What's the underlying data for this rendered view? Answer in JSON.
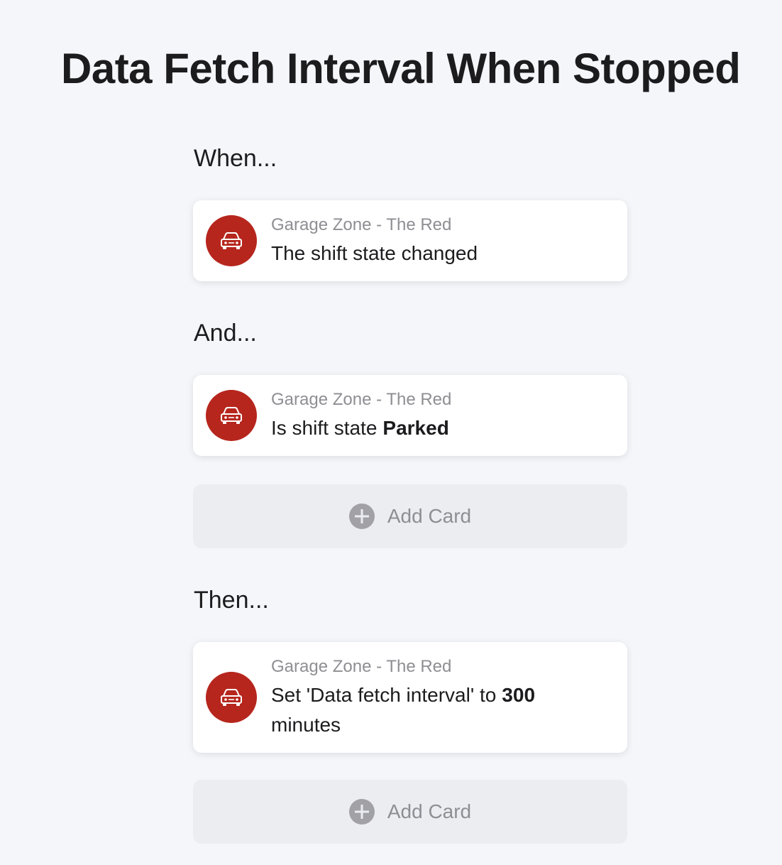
{
  "page": {
    "title": "Data Fetch Interval When Stopped"
  },
  "sections": {
    "when": {
      "label": "When...",
      "card": {
        "zone": "Garage Zone - The Red",
        "description": "The shift state changed",
        "icon": "car-icon"
      }
    },
    "and": {
      "label": "And...",
      "card": {
        "zone": "Garage Zone - The Red",
        "description_prefix": "Is shift state",
        "description_value": "Parked",
        "icon": "car-icon"
      },
      "add_card_label": "Add Card"
    },
    "then": {
      "label": "Then...",
      "card": {
        "zone": "Garage Zone - The Red",
        "description_prefix": "Set 'Data fetch interval' to",
        "description_value": "300",
        "description_suffix": "minutes",
        "icon": "car-icon"
      },
      "add_card_label": "Add Card"
    }
  },
  "colors": {
    "accent": "#b6261d",
    "background": "#f4f6fa",
    "card": "#ffffff",
    "add_card_bg": "#ebedf1",
    "muted_text": "#8e8e93"
  }
}
